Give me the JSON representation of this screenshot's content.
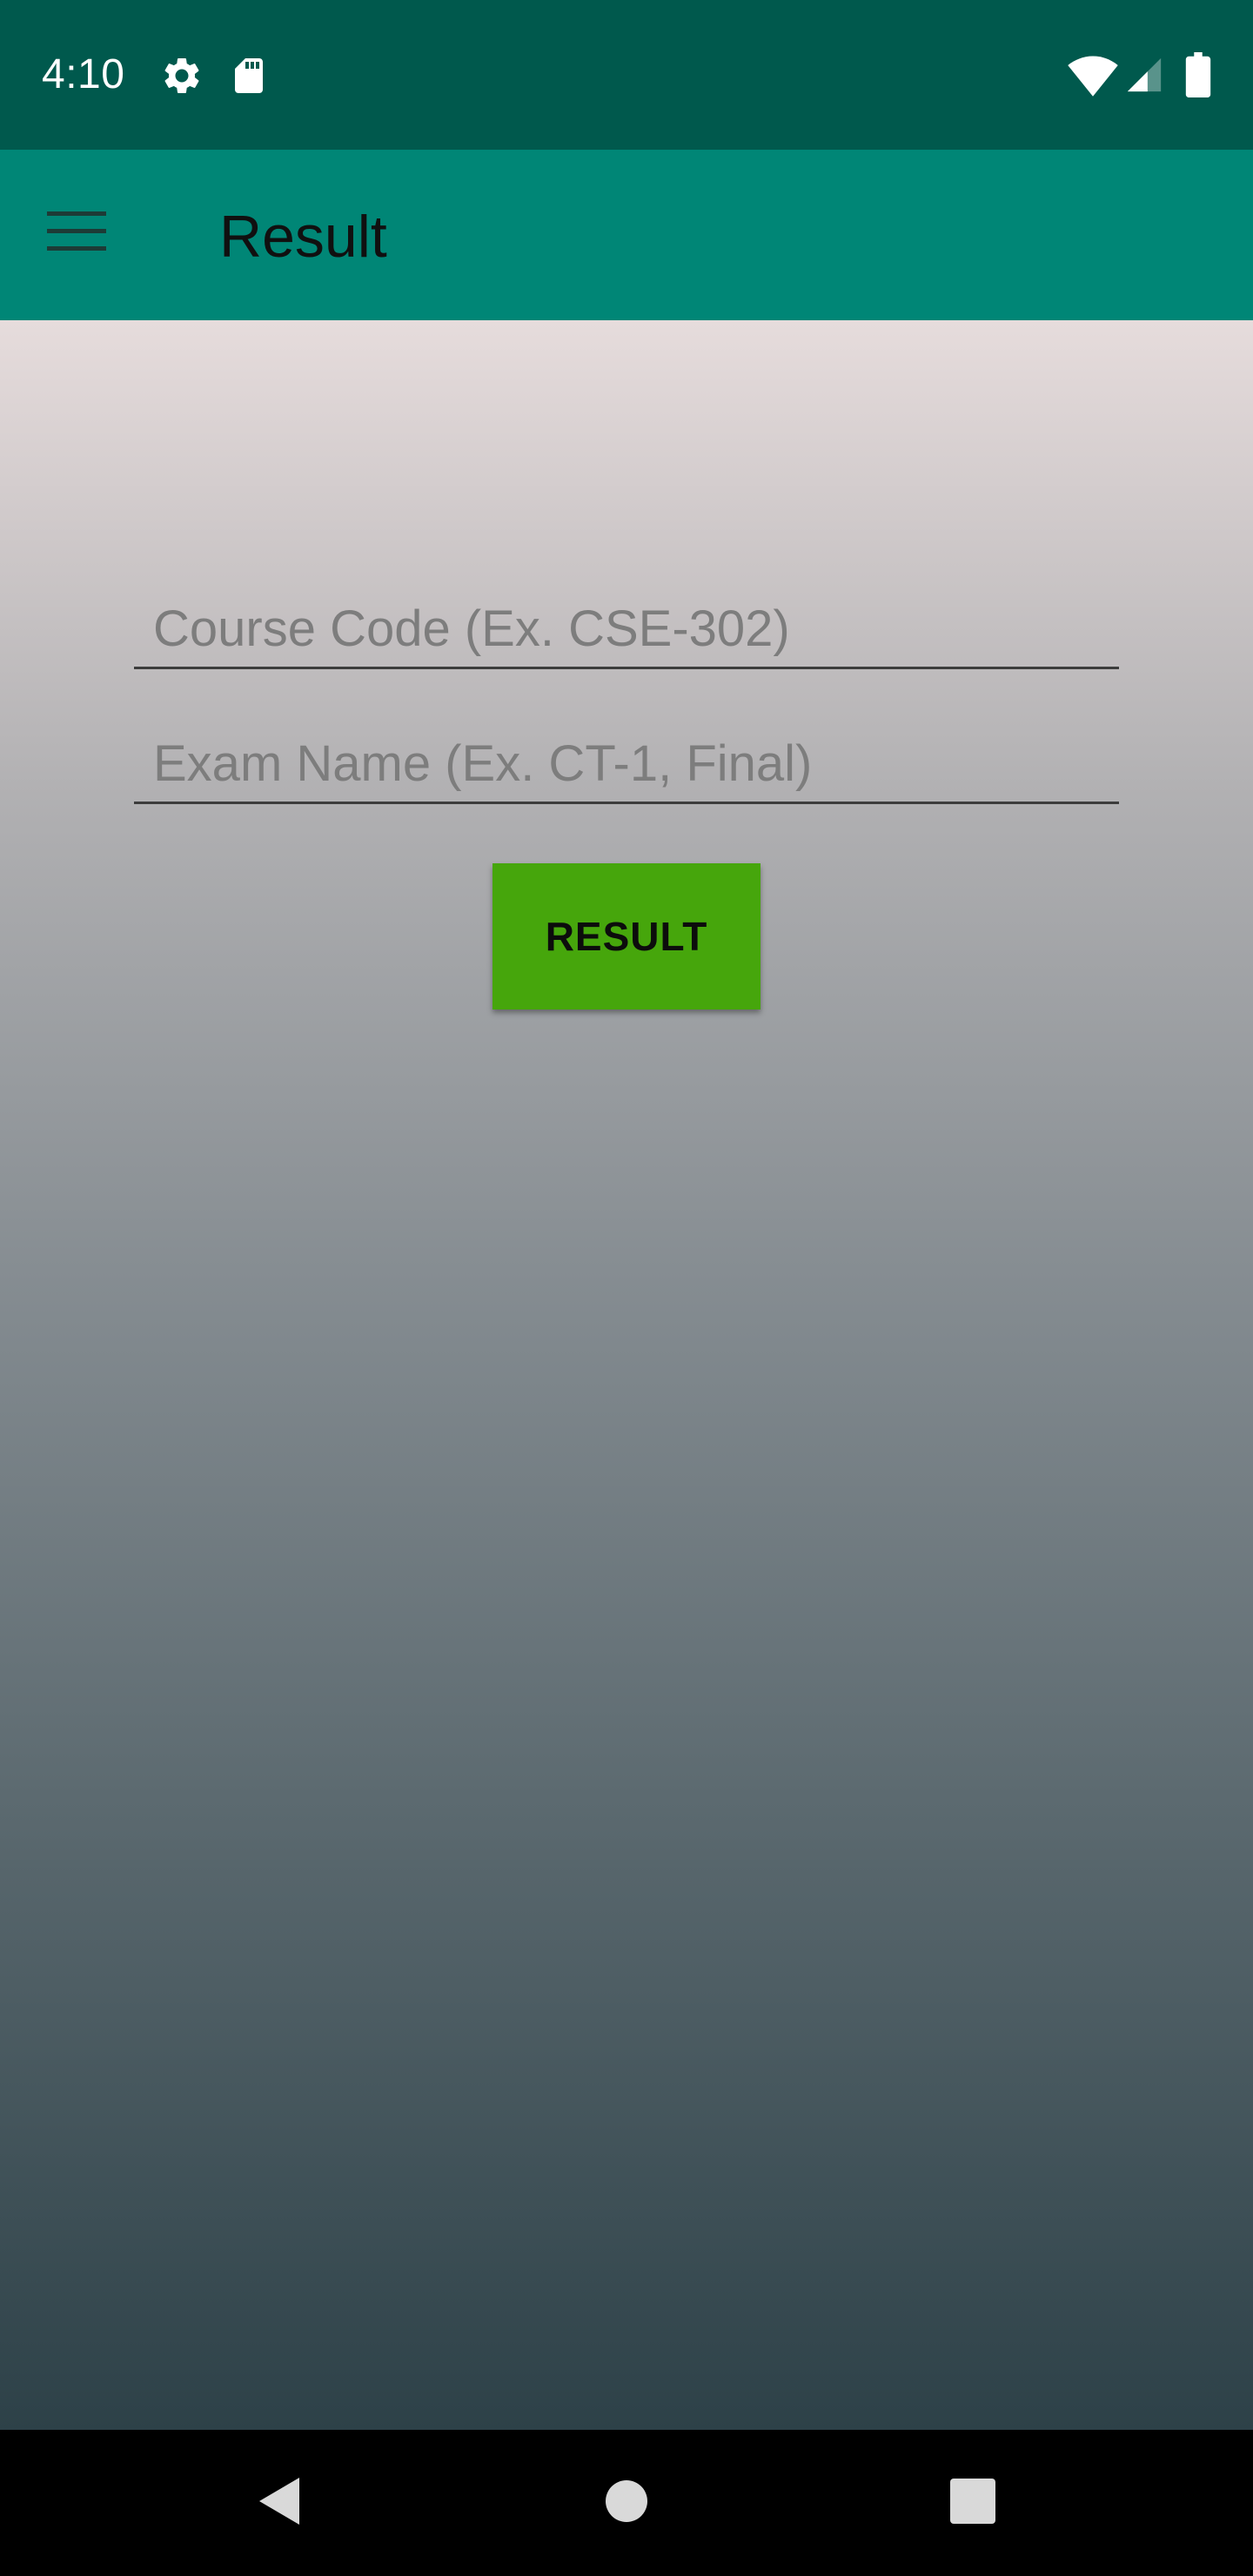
{
  "status_bar": {
    "time": "4:10",
    "icons": [
      "settings-icon",
      "sd-card-icon",
      "wifi-icon",
      "cell-signal-icon",
      "battery-icon"
    ]
  },
  "app_bar": {
    "title": "Result",
    "menu_icon": "hamburger-menu-icon"
  },
  "form": {
    "course_code_placeholder": "Course Code (Ex. CSE-302)",
    "course_code_value": "",
    "exam_name_placeholder": "Exam Name (Ex. CT-1, Final)",
    "exam_name_value": "",
    "submit_label": "RESULT"
  },
  "nav_bar": {
    "icons": [
      "back-icon",
      "home-icon",
      "recents-icon"
    ]
  },
  "colors": {
    "status_bar": "#00594d",
    "app_bar": "#008676",
    "button": "#46a60c"
  }
}
